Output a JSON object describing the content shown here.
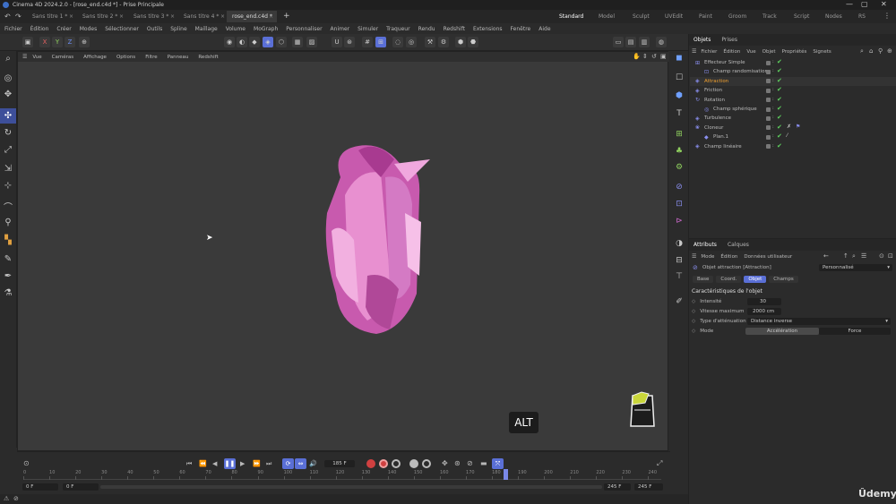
{
  "window": {
    "title": "Cinema 4D 2024.2.0 - [rose_end.c4d *] - Prise Principale",
    "controls": [
      "minimize-icon",
      "maximize-icon",
      "close-icon"
    ]
  },
  "doc_tabs": [
    {
      "label": "Sans titre 1 *"
    },
    {
      "label": "Sans titre 2 *"
    },
    {
      "label": "Sans titre 3 *"
    },
    {
      "label": "Sans titre 4 *"
    },
    {
      "label": "rose_end.c4d *",
      "active": true
    }
  ],
  "layouts": [
    "Standard",
    "Model",
    "Sculpt",
    "UVEdit",
    "Paint",
    "Groom",
    "Track",
    "Script",
    "Nodes",
    "RS"
  ],
  "menu": [
    "Fichier",
    "Édition",
    "Créer",
    "Modes",
    "Sélectionner",
    "Outils",
    "Spline",
    "Maillage",
    "Volume",
    "MoGraph",
    "Personnaliser",
    "Animer",
    "Simuler",
    "Traqueur",
    "Rendu",
    "Redshift",
    "Extensions",
    "Fenêtre",
    "Aide"
  ],
  "toolbar": {
    "axes": [
      "X",
      "Y",
      "Z"
    ]
  },
  "viewport": {
    "menu": [
      "Vue",
      "Caméras",
      "Affichage",
      "Options",
      "Filtre",
      "Panneau",
      "Redshift"
    ],
    "alt_badge": "ALT"
  },
  "objects_panel": {
    "tabs": [
      "Objets",
      "Prises"
    ],
    "menu": [
      "Fichier",
      "Édition",
      "Vue",
      "Objet",
      "Propriétés",
      "Signets"
    ],
    "items": [
      {
        "label": "Effecteur Simple",
        "indent": 0
      },
      {
        "label": "Champ randomisation",
        "indent": 1
      },
      {
        "label": "Attraction",
        "indent": 0,
        "selected": true
      },
      {
        "label": "Friction",
        "indent": 0
      },
      {
        "label": "Rotation",
        "indent": 0
      },
      {
        "label": "Champ sphérique",
        "indent": 1
      },
      {
        "label": "Turbulence",
        "indent": 0
      },
      {
        "label": "Cloneur",
        "indent": 0
      },
      {
        "label": "Plan.1",
        "indent": 1
      },
      {
        "label": "Champ linéaire",
        "indent": 0
      }
    ]
  },
  "attributes_panel": {
    "tabs": [
      "Attributs",
      "Calques"
    ],
    "menu": [
      "Mode",
      "Édition",
      "Données utilisateur"
    ],
    "object_label": "Objet attraction [Attraction]",
    "preset": "Personnalisé",
    "subtabs": [
      "Base",
      "Coord.",
      "Objet",
      "Champs"
    ],
    "active_subtab": "Objet",
    "section": "Caractéristiques de l'objet",
    "props": {
      "intensity_label": "Intensité",
      "intensity_value": "30",
      "speed_label": "Vitesse maximum",
      "speed_value": "2000 cm",
      "falloff_label": "Type d'atténuation",
      "falloff_value": "Distance inverse",
      "mode_label": "Mode",
      "mode_a": "Accélération",
      "mode_b": "Force"
    }
  },
  "timeline": {
    "current_frame": "185 F",
    "start": "0 F",
    "start2": "0 F",
    "end": "245 F",
    "end2": "245 F",
    "ticks": [
      "0",
      "10",
      "20",
      "30",
      "40",
      "50",
      "60",
      "70",
      "80",
      "90",
      "100",
      "110",
      "120",
      "130",
      "140",
      "150",
      "160",
      "170",
      "180",
      "190",
      "200",
      "210",
      "220",
      "230",
      "240"
    ],
    "playhead_frame": 185
  },
  "watermark": "Ûdemy",
  "colors": {
    "accent": "#5a6fd6",
    "selected_text": "#f0a030",
    "rose": "#d86fc0"
  }
}
